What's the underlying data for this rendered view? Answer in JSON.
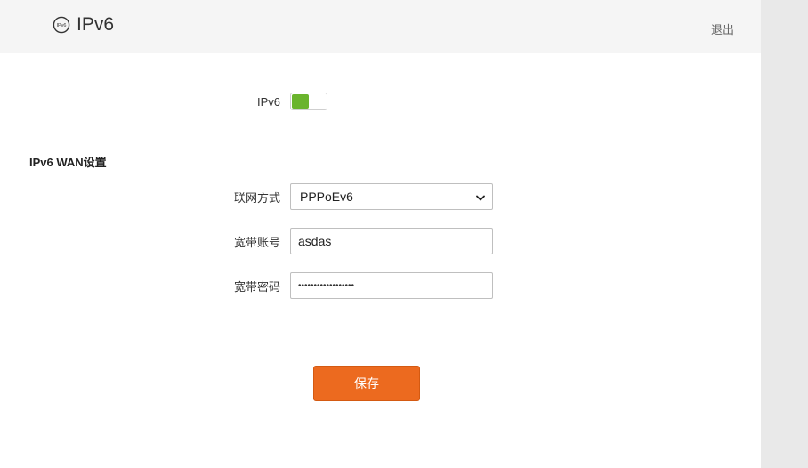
{
  "header": {
    "icon": "ipv6-circle-icon",
    "icon_text": "IPv6",
    "title": "IPv6",
    "logout_label": "退出"
  },
  "ipv6_toggle": {
    "label": "IPv6",
    "enabled": true,
    "accent_color": "#6ab42d"
  },
  "wan_section": {
    "title": "IPv6 WAN设置",
    "connection_type": {
      "label": "联网方式",
      "selected": "PPPoEv6"
    },
    "account": {
      "label": "宽带账号",
      "value": "asdas"
    },
    "password": {
      "label": "宽带密码",
      "masked_value": "••••••••••••••••••"
    }
  },
  "actions": {
    "save_label": "保存",
    "save_color": "#ec6a1f"
  }
}
